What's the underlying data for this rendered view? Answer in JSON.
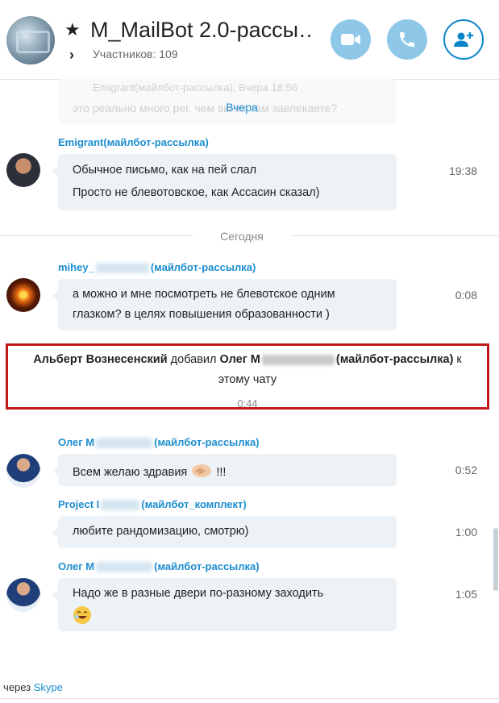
{
  "header": {
    "title": "M_MailBot 2.0-рассы…",
    "members": "Участников: 109"
  },
  "ghost": {
    "line1": "Emigrant(майлбот-рассылка), Вчера 18:56",
    "line2": "это реально много рег, чем вы их там завлекаете?"
  },
  "days": {
    "yesterday": "Вчера",
    "today": "Сегодня"
  },
  "messages": [
    {
      "sender": "Emigrant(майлбот-рассылка)",
      "lines": [
        "Обычное письмо, как на пей слал",
        "Просто не блевотовское, как Ассасин сказал)"
      ],
      "time": "19:38"
    },
    {
      "sender_prefix": "mihey_",
      "sender_suffix": "(майлбот-рассылка)",
      "lines": [
        "а можно и мне посмотреть не блевотское одним",
        "глазком? в целях повышения образованности )"
      ],
      "time": "0:08"
    },
    {
      "sender_prefix": "Олег М",
      "sender_suffix": "(майлбот-рассылка)",
      "lines": [
        "Всем желаю здравия",
        "!!!"
      ],
      "time": "0:52"
    },
    {
      "sender_prefix": "Project I",
      "sender_suffix": "(майлбот_комплект)",
      "lines": [
        "любите рандомизацию, смотрю)"
      ],
      "time": "1:00"
    },
    {
      "sender_prefix": "Олег М",
      "sender_suffix": "(майлбот-рассылка)",
      "lines": [
        "Надо же в разные двери по-разному заходить"
      ],
      "time": "1:05"
    }
  ],
  "system": {
    "actor": "Альберт Вознесенский",
    "verb": " добавил ",
    "target_prefix": "Олег М",
    "target_suffix": "(майлбот-рассылка)",
    "tail": " к",
    "line2": "этому чату",
    "time": "0:44"
  },
  "footer": {
    "via": "через ",
    "link": "Skype"
  },
  "colors": {
    "accent": "#1c8dd0",
    "highlight_border": "#c1171b",
    "bubble": "#edf2f6"
  }
}
